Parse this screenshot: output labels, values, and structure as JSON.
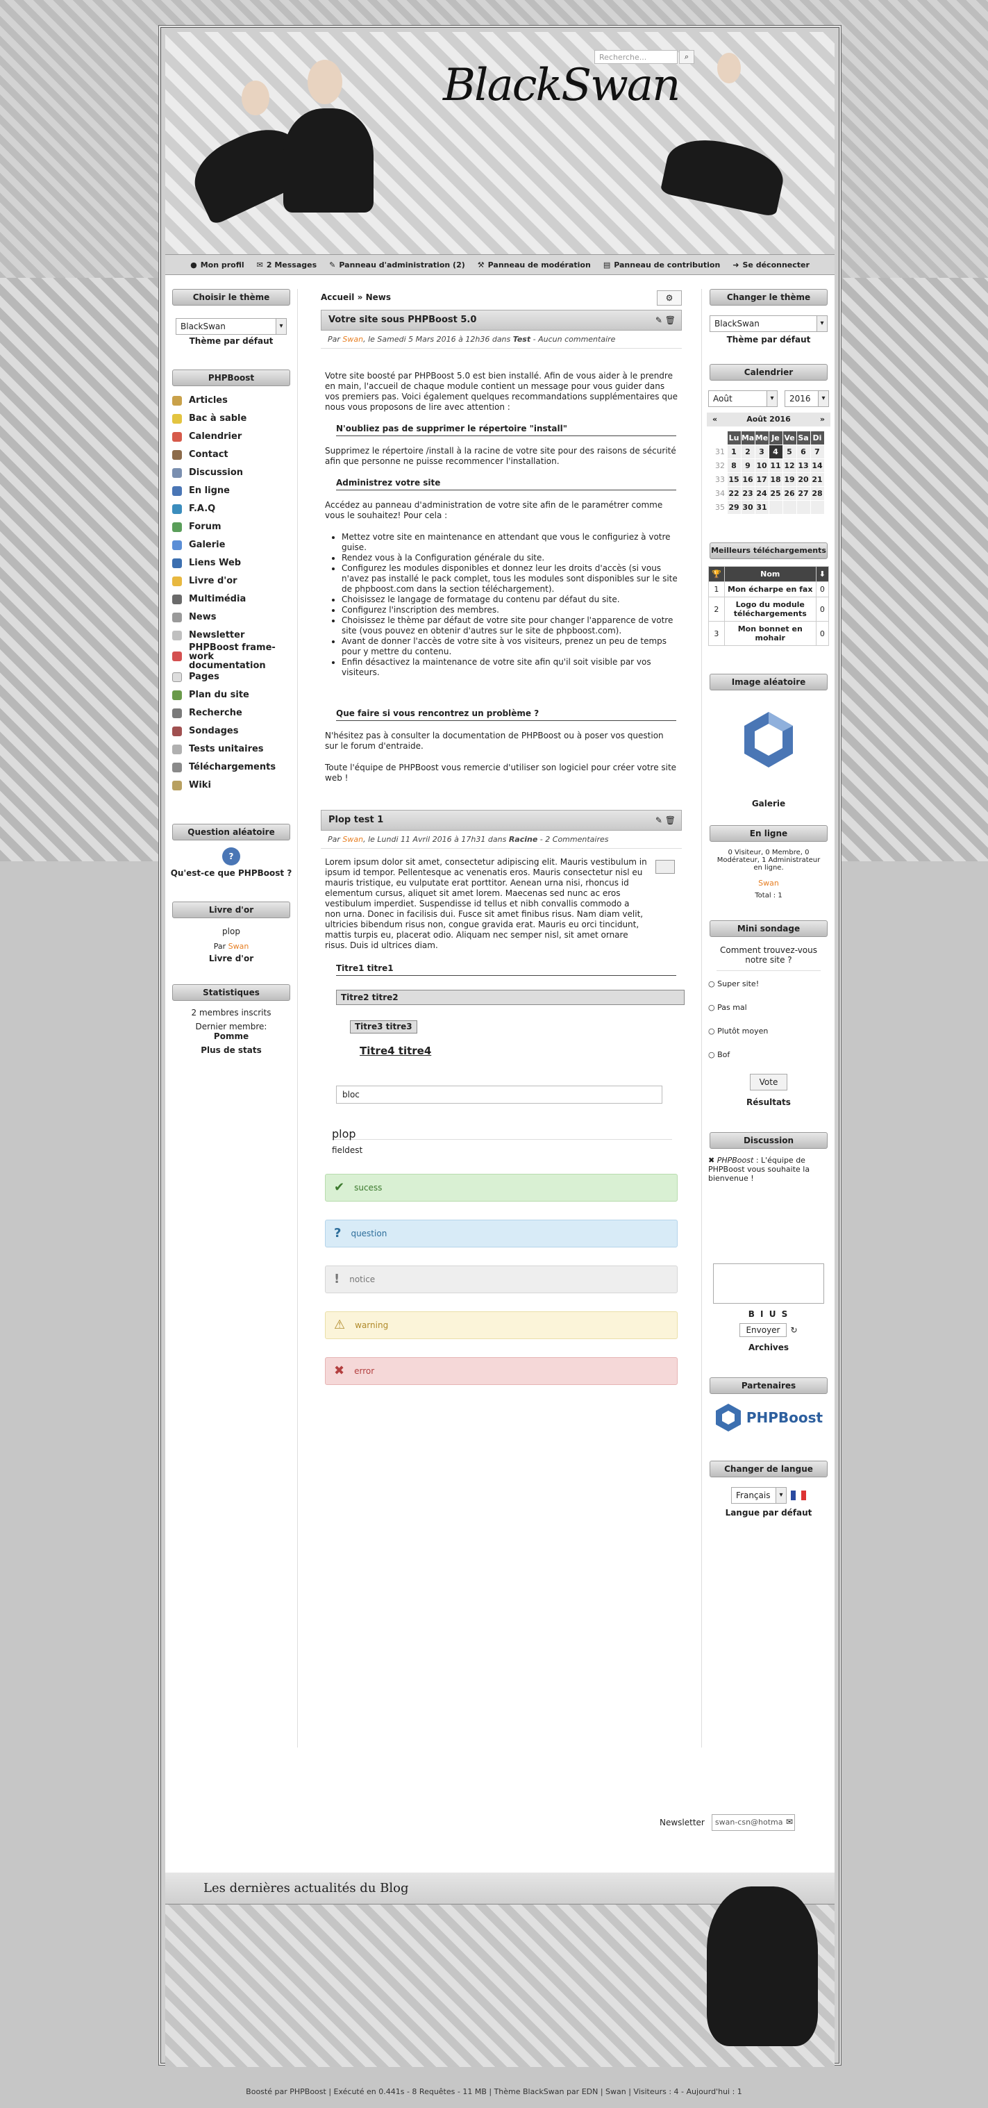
{
  "header": {
    "site_title": "BlackSwan",
    "search_placeholder": "Recherche...",
    "search_icon": "search-icon"
  },
  "topbar": [
    {
      "icon": "user-icon",
      "label": "Mon profil"
    },
    {
      "icon": "envelope-icon",
      "label": "2 Messages"
    },
    {
      "icon": "wrench-icon",
      "label": "Panneau d'administration (2)"
    },
    {
      "icon": "gavel-icon",
      "label": "Panneau de modération"
    },
    {
      "icon": "file-icon",
      "label": "Panneau de contribution"
    },
    {
      "icon": "logout-icon",
      "label": "Se déconnecter"
    }
  ],
  "left": {
    "theme_title": "Choisir le thème",
    "theme_value": "BlackSwan",
    "theme_default": "Thème par défaut",
    "phpboost_title": "PHPBoost",
    "menu": [
      "Articles",
      "Bac à sable",
      "Calendrier",
      "Contact",
      "Discussion",
      "En ligne",
      "F.A.Q",
      "Forum",
      "Galerie",
      "Liens Web",
      "Livre d'or",
      "Multimédia",
      "News",
      "Newsletter",
      "PHPBoost frame-work documentation",
      "Pages",
      "Plan du site",
      "Recherche",
      "Sondages",
      "Tests unitaires",
      "Téléchargements",
      "Wiki"
    ],
    "question_title": "Question aléatoire",
    "question_text": "Qu'est-ce que PHPBoost ?",
    "guestbook_title": "Livre d'or",
    "guestbook_msg": "plop",
    "guestbook_by": "Par",
    "guestbook_author": "Swan",
    "guestbook_link": "Livre d'or",
    "stats_title": "Statistiques",
    "stats_members": "2 membres inscrits",
    "stats_last": "Dernier membre:",
    "stats_last_name": "Pomme",
    "stats_more": "Plus de stats"
  },
  "main": {
    "breadcrumb_home": "Accueil",
    "breadcrumb_sep": "»",
    "breadcrumb_current": "News",
    "news1": {
      "title": "Votre site sous PHPBoost 5.0",
      "meta_by": "Par",
      "author": "Swan",
      "meta_rest": ", le Samedi 5 Mars 2016 à 12h36 dans",
      "category": "Test",
      "comments": "- Aucun commentaire",
      "p1": "Votre site boosté par PHPBoost 5.0 est bien installé. Afin de vous aider à le prendre en main, l'accueil de chaque module contient un message pour vous guider dans vos premiers pas. Voici également quelques recommandations supplémentaires que nous vous proposons de lire avec attention :",
      "h1": "N'oubliez pas de supprimer le répertoire \"install\"",
      "p2": "Supprimez le répertoire /install à la racine de votre site pour des raisons de sécurité afin que personne ne puisse recommencer l'installation.",
      "h2": "Administrez votre site",
      "p3": "Accédez au panneau d'administration de votre site afin de le paramétrer comme vous le souhaitez! Pour cela :",
      "list": [
        "Mettez votre site en maintenance en attendant que vous le configuriez à votre guise.",
        "Rendez vous à la Configuration générale du site.",
        "Configurez les modules disponibles et donnez leur les droits d'accès (si vous n'avez pas installé le pack complet, tous les modules sont disponibles sur le site de phpboost.com dans la section téléchargement).",
        "Choisissez le langage de formatage du contenu par défaut du site.",
        "Configurez l'inscription des membres.",
        "Choisissez le thème par défaut de votre site pour changer l'apparence de votre site (vous pouvez en obtenir d'autres sur le site de phpboost.com).",
        "Avant de donner l'accès de votre site à vos visiteurs, prenez un peu de temps pour y mettre du contenu.",
        "Enfin désactivez la maintenance de votre site afin qu'il soit visible par vos visiteurs."
      ],
      "h3": "Que faire si vous rencontrez un problème ?",
      "p4": "N'hésitez pas à consulter la documentation de PHPBoost ou à poser vos question sur le forum d'entraide.",
      "p5": "Toute l'équipe de PHPBoost vous remercie d'utiliser son logiciel pour créer votre site web !"
    },
    "news2": {
      "title": "Plop test 1",
      "meta_by": "Par",
      "author": "Swan",
      "meta_rest": ", le Lundi 11 Avril 2016 à 17h31 dans",
      "category": "Racine",
      "comments": "- 2 Commentaires",
      "lorem": "Lorem ipsum dolor sit amet, consectetur adipiscing elit. Mauris vestibulum in ipsum id tempor. Pellentesque ac venenatis eros. Mauris consectetur nisl eu mauris tristique, eu vulputate erat porttitor. Aenean urna nisi, rhoncus id elementum cursus, aliquet sit amet lorem. Maecenas sed nunc ac eros vestibulum imperdiet. Suspendisse id tellus et nibh convallis commodo a non urna. Donec in facilisis dui. Fusce sit amet finibus risus. Nam diam velit, ultricies bibendum risus non, congue gravida erat. Mauris eu orci tincidunt, mattis turpis eu, placerat odio. Aliquam nec semper nisl, sit amet ornare risus. Duis id ultrices diam.",
      "t1": "Titre1 titre1",
      "t2": "Titre2 titre2",
      "t3": "Titre3 titre3",
      "t4": "Titre4 titre4",
      "bloc": "bloc",
      "fieldset_legend": "plop",
      "fieldset_text": "fieldest",
      "alerts": {
        "success": "sucess",
        "question": "question",
        "notice": "notice",
        "warning": "warning",
        "error": "error"
      }
    }
  },
  "right": {
    "theme_title": "Changer le thème",
    "theme_value": "BlackSwan",
    "theme_default": "Thème par défaut",
    "cal_title": "Calendrier",
    "cal_month": "Août",
    "cal_year": "2016",
    "cal_nav_prev": "«",
    "cal_label": "Août 2016",
    "cal_nav_next": "»",
    "cal_head": [
      "",
      "Lu",
      "Ma",
      "Me",
      "Je",
      "Ve",
      "Sa",
      "Di"
    ],
    "cal_rows": [
      [
        "31",
        "1",
        "2",
        "3",
        "4",
        "5",
        "6",
        "7"
      ],
      [
        "32",
        "8",
        "9",
        "10",
        "11",
        "12",
        "13",
        "14"
      ],
      [
        "33",
        "15",
        "16",
        "17",
        "18",
        "19",
        "20",
        "21"
      ],
      [
        "34",
        "22",
        "23",
        "24",
        "25",
        "26",
        "27",
        "28"
      ],
      [
        "35",
        "29",
        "30",
        "31",
        "",
        "",
        "",
        ""
      ]
    ],
    "dl_title": "Meilleurs téléchargements",
    "dl_col": "Nom",
    "dl_rows": [
      [
        "1",
        "Mon écharpe en fax",
        "0"
      ],
      [
        "2",
        "Logo du module téléchargements",
        "0"
      ],
      [
        "3",
        "Mon bonnet en mohair",
        "0"
      ]
    ],
    "img_title": "Image aléatoire",
    "img_caption": "Galerie",
    "online_title": "En ligne",
    "online_text": "0 Visiteur, 0 Membre, 0 Modérateur, 1 Administrateur en ligne.",
    "online_user": "Swan",
    "online_total": "Total : 1",
    "poll_title": "Mini sondage",
    "poll_question": "Comment trouvez-vous notre site ?",
    "poll_options": [
      "Super site!",
      "Pas mal",
      "Plutôt moyen",
      "Bof"
    ],
    "poll_vote": "Vote",
    "poll_results": "Résultats",
    "disc_title": "Discussion",
    "disc_author": "PHPBoost",
    "disc_text": ": L'équipe de PHPBoost vous souhaite la bienvenue !",
    "disc_tools": "B I U S",
    "disc_send": "Envoyer",
    "disc_archives": "Archives",
    "partners_title": "Partenaires",
    "partner_logo": "PHPBoost",
    "lang_title": "Changer de langue",
    "lang_value": "Français",
    "lang_default": "Langue par défaut"
  },
  "newsletter": {
    "label": "Newsletter",
    "placeholder": "swan-csn@hotma"
  },
  "footer": {
    "title": "Les dernières actualités du Blog",
    "bottom": "Boosté par PHPBoost | Exécuté en 0.441s - 8 Requêtes - 11 MB | Thème BlackSwan par EDN | Swan | Visiteurs : 4 - Aujourd'hui : 1"
  },
  "colors": {
    "accent": "#e67e22",
    "success": "#d9f0d3",
    "question": "#d8ebf7",
    "notice": "#eeeeee",
    "warning": "#fbf4d9",
    "error": "#f5d8d8"
  }
}
